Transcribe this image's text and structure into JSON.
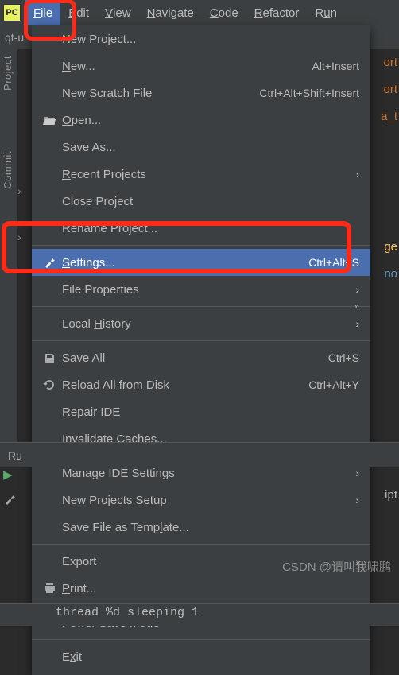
{
  "menubar": {
    "app_icon": "PC",
    "items": [
      {
        "label": "File",
        "mnemonic": "F",
        "open": true
      },
      {
        "label": "Edit",
        "mnemonic": "E"
      },
      {
        "label": "View",
        "mnemonic": "V"
      },
      {
        "label": "Navigate",
        "mnemonic": "N"
      },
      {
        "label": "Code",
        "mnemonic": "C"
      },
      {
        "label": "Refactor",
        "mnemonic": "R"
      },
      {
        "label": "Run",
        "mnemonic": "u",
        "partial": "Ru"
      }
    ]
  },
  "tab": {
    "prefix": "qt-u"
  },
  "sidebar": {
    "labels": [
      "Project",
      "Commit"
    ]
  },
  "dropdown": {
    "items": [
      {
        "label": "New Project...",
        "icon": ""
      },
      {
        "label": "New...",
        "mnemonic": "N",
        "shortcut": "Alt+Insert"
      },
      {
        "label": "New Scratch File",
        "shortcut": "Ctrl+Alt+Shift+Insert"
      },
      {
        "label": "Open...",
        "mnemonic": "O",
        "icon": "folder"
      },
      {
        "label": "Save As..."
      },
      {
        "label": "Recent Projects",
        "mnemonic": "R",
        "submenu": true
      },
      {
        "label": "Close Project",
        "mnemonic": "j",
        "before": "Close Pro",
        "after": "ect"
      },
      {
        "label": "Rename Project..."
      },
      {
        "sep": true
      },
      {
        "label": "Settings...",
        "mnemonic": "S",
        "icon": "wrench",
        "shortcut": "Ctrl+Alt+S",
        "highlight": true
      },
      {
        "label": "File Properties",
        "submenu": true
      },
      {
        "sep": true
      },
      {
        "label": "Local History",
        "mnemonic": "H",
        "before": "Local ",
        "after": "istory",
        "submenu": true,
        "micro": "»"
      },
      {
        "sep": true
      },
      {
        "label": "Save All",
        "mnemonic": "S",
        "icon": "save",
        "shortcut": "Ctrl+S"
      },
      {
        "label": "Reload All from Disk",
        "icon": "reload",
        "shortcut": "Ctrl+Alt+Y"
      },
      {
        "label": "Repair IDE"
      },
      {
        "label": "Invalidate Caches..."
      },
      {
        "sep": true
      },
      {
        "label": "Manage IDE Settings",
        "submenu": true
      },
      {
        "label": "New Projects Setup",
        "submenu": true
      },
      {
        "label": "Save File as Template...",
        "mnemonic": "l",
        "before": "Save File as Temp",
        "after": "ate..."
      },
      {
        "sep": true
      },
      {
        "label": "Export",
        "submenu": true
      },
      {
        "label": "Print...",
        "mnemonic": "P",
        "icon": "print"
      },
      {
        "sep": true
      },
      {
        "label": "Power Save Mode"
      },
      {
        "sep": true
      },
      {
        "label": "Exit",
        "mnemonic": "x",
        "before": "E",
        "after": "it"
      }
    ]
  },
  "code_peek": [
    "ort",
    "ort",
    "",
    "a_t",
    "",
    "",
    "ge",
    "no",
    "",
    "",
    ""
  ],
  "run_label": "Ru",
  "ipt_text": "ipt",
  "terminal": "thread  %d    sleeping 1",
  "watermark": "CSDN @请叫我啸鹏"
}
